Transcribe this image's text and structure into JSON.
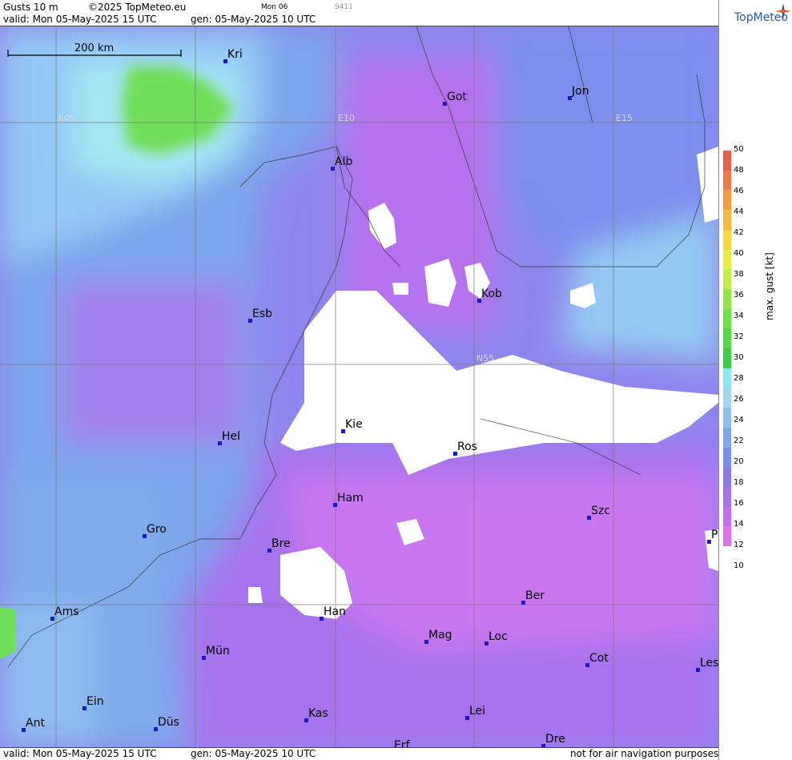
{
  "header": {
    "product": "Gusts 10 m",
    "copyright": "©2025 TopMeteo.eu",
    "day": "Mon 06",
    "code": "9411",
    "valid": "valid:  Mon  05-May-2025  15 UTC",
    "gen": "gen: 05-May-2025 10 UTC",
    "logo": "TopMeteo"
  },
  "footer": {
    "valid": "valid:  Mon  05-May-2025  15 UTC",
    "gen": "gen: 05-May-2025 10 UTC",
    "disclaimer": "not for air navigation purposes"
  },
  "scale_bar": "200 km",
  "grid_labels": [
    "E05",
    "E10",
    "E15",
    "N55"
  ],
  "cities": [
    "Kri",
    "Got",
    "Jon",
    "Alb",
    "Kob",
    "Esb",
    "Kie",
    "Ros",
    "Hel",
    "Ham",
    "Szc",
    "Gro",
    "Bre",
    "P",
    "Ber",
    "Ams",
    "Han",
    "Mag",
    "Loc",
    "Cot",
    "Mün",
    "Les",
    "Ein",
    "Kas",
    "Lei",
    "Ant",
    "Düs",
    "Dre",
    "Erf"
  ],
  "legend": {
    "title": "max. gust [kt]",
    "ticks": [
      "50",
      "48",
      "46",
      "44",
      "42",
      "40",
      "38",
      "36",
      "34",
      "32",
      "30",
      "28",
      "26",
      "24",
      "22",
      "20",
      "18",
      "16",
      "14",
      "12",
      "10"
    ],
    "colors": [
      "#e8604c",
      "#f07a48",
      "#f69844",
      "#f9b840",
      "#f8d640",
      "#e8ec44",
      "#c0ec46",
      "#94e648",
      "#6ee048",
      "#52d848",
      "#3ccc48",
      "#8ee8f0",
      "#9ed6f4",
      "#90c0f2",
      "#80a6ee",
      "#7a8ef0",
      "#8a7aee",
      "#a872ee",
      "#c86ef0",
      "#e070f0"
    ]
  },
  "colors": {
    "water": "#7fa8ec",
    "land": "#c87cf0",
    "calm": "#ffffff",
    "strong": "#6fde58"
  }
}
